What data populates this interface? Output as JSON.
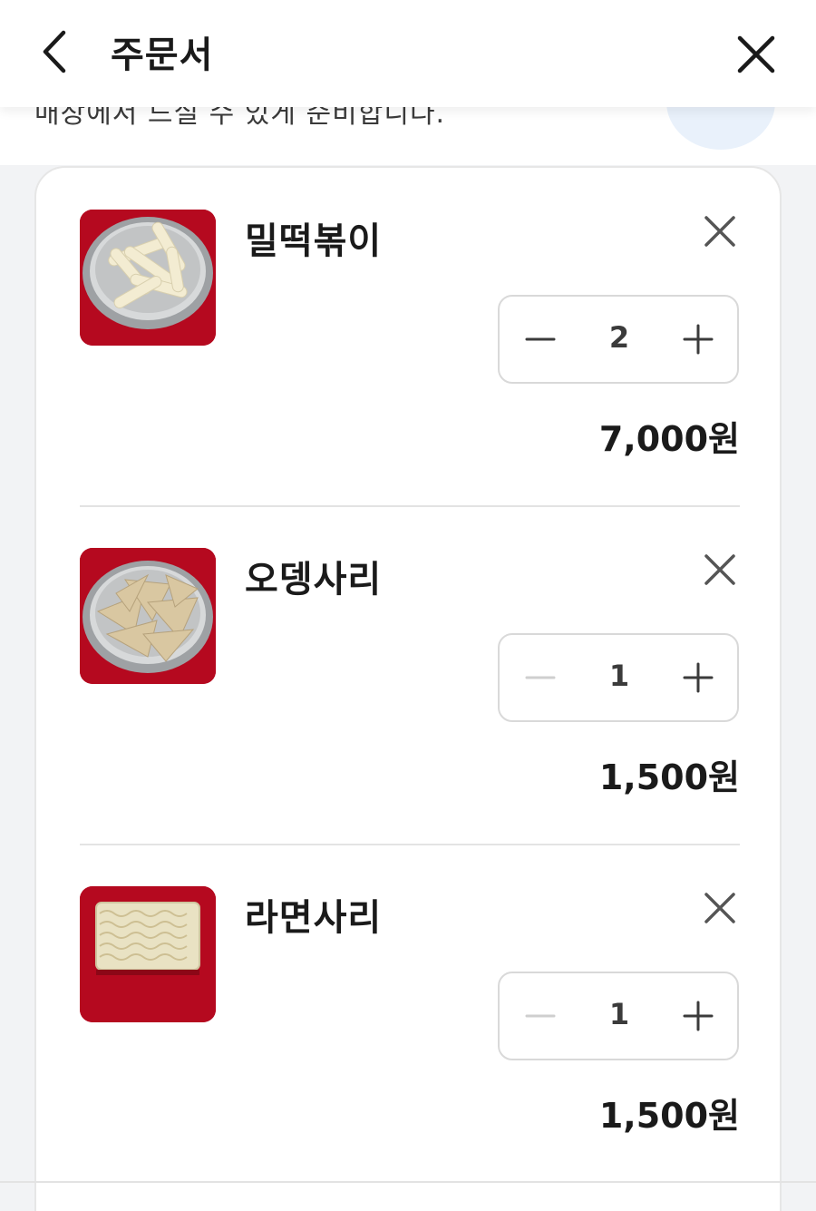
{
  "header": {
    "title": "주문서",
    "back_icon": "chevron-left-icon",
    "close_icon": "close-icon"
  },
  "notice": {
    "text": "매장에서 드실 수 있게 준비합니다."
  },
  "items": [
    {
      "name": "밀떡볶이",
      "quantity": "2",
      "price": "7,000원",
      "minus_enabled": true,
      "thumb": "rice-cake-icon"
    },
    {
      "name": "오뎅사리",
      "quantity": "1",
      "price": "1,500원",
      "minus_enabled": false,
      "thumb": "fish-cake-icon"
    },
    {
      "name": "라면사리",
      "quantity": "1",
      "price": "1,500원",
      "minus_enabled": false,
      "thumb": "ramen-noodle-icon"
    }
  ],
  "colors": {
    "accent_bg": "#b5091f",
    "text_primary": "#1a1a1a",
    "border": "#d9d9d9",
    "disabled": "#c8c8c8"
  }
}
